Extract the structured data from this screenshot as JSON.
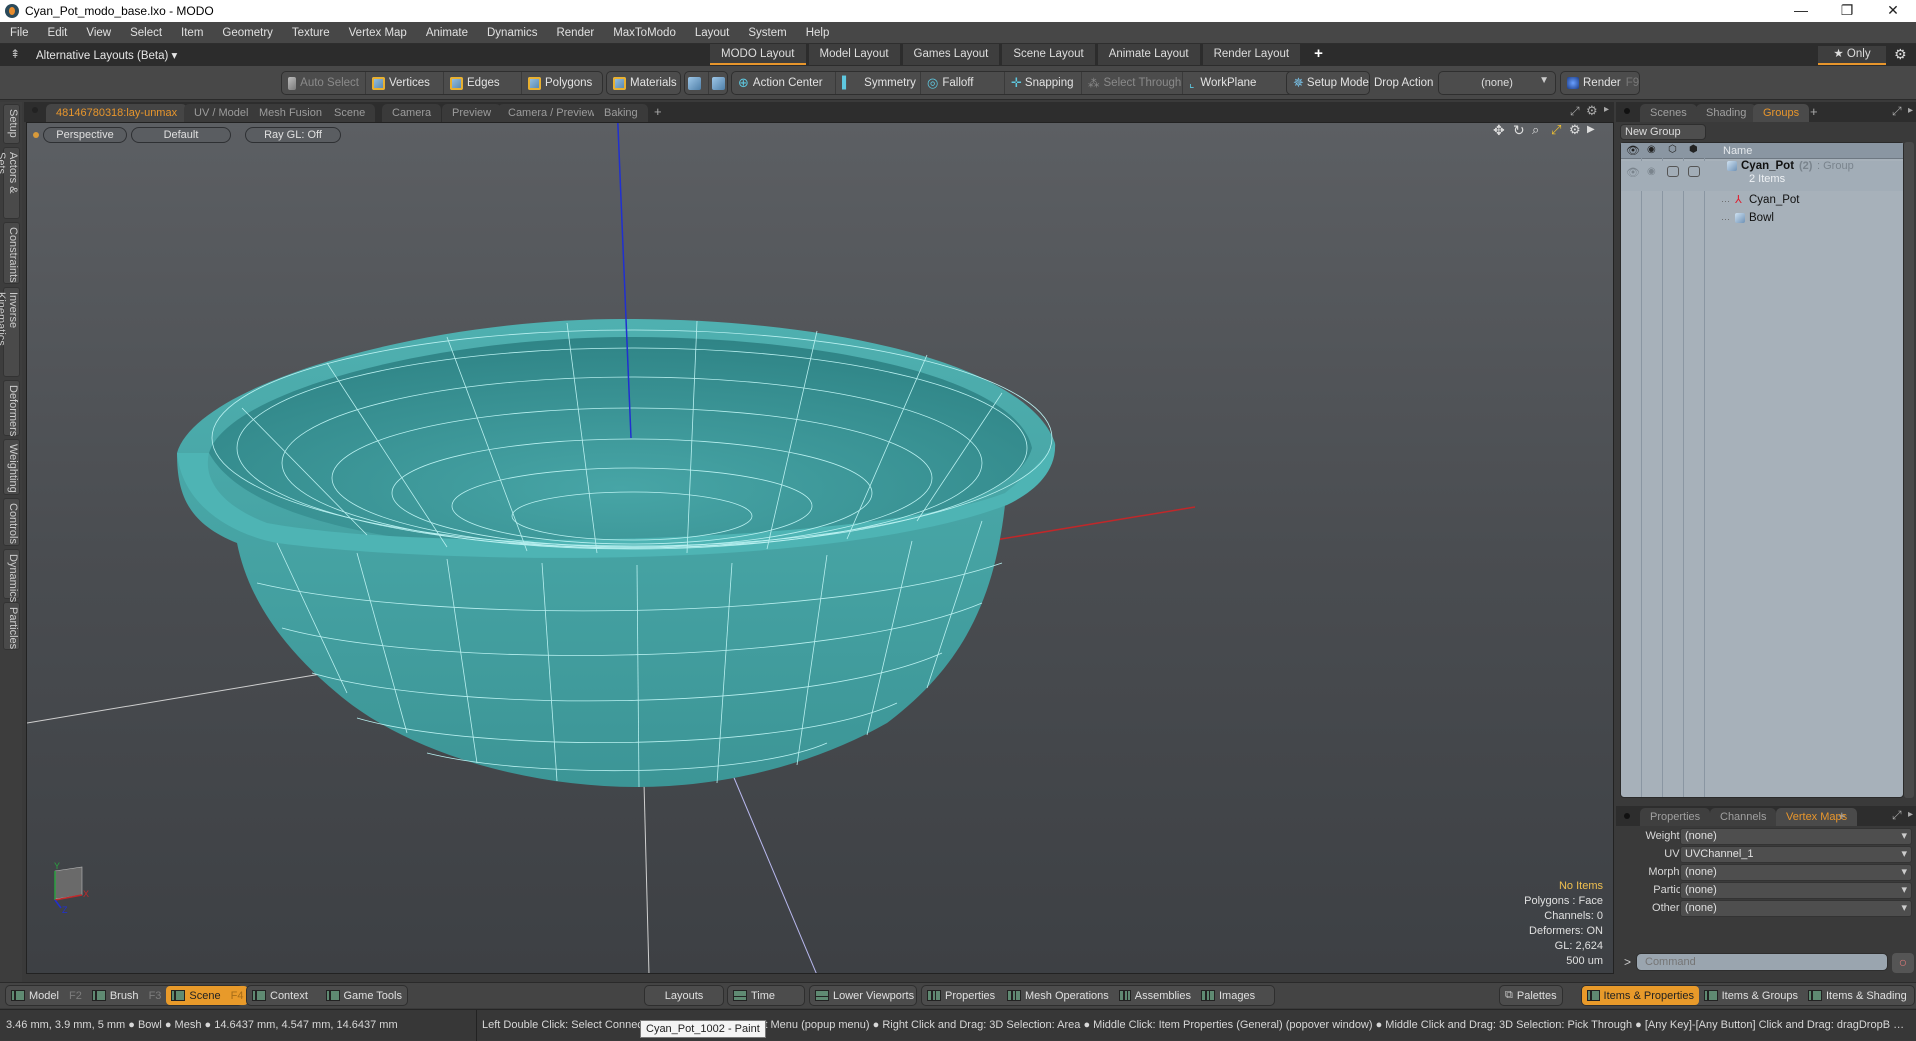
{
  "window": {
    "title": "Cyan_Pot_modo_base.lxo - MODO",
    "controls": {
      "minimize": "—",
      "restore": "❐",
      "close": "✕"
    }
  },
  "menubar": [
    "File",
    "Edit",
    "View",
    "Select",
    "Item",
    "Geometry",
    "Texture",
    "Vertex Map",
    "Animate",
    "Dynamics",
    "Render",
    "MaxToModo",
    "Layout",
    "System",
    "Help"
  ],
  "layoutbar": {
    "alt_layouts": "Alternative Layouts (Beta) ▾",
    "tabs": [
      "MODO Layout",
      "Model Layout",
      "Games Layout",
      "Scene Layout",
      "Animate Layout",
      "Render Layout"
    ],
    "active_tab": "MODO Layout",
    "add": "+",
    "only": "★  Only",
    "gear": "⚙"
  },
  "toolbar": {
    "auto_select": "Auto Select",
    "vertices": "Vertices",
    "edges": "Edges",
    "polygons": "Polygons",
    "materials": "Materials",
    "action_center": "Action Center",
    "symmetry": "Symmetry",
    "falloff": "Falloff",
    "snapping": "Snapping",
    "select_through": "Select Through",
    "workplane": "WorkPlane",
    "setup_mode": "Setup Mode",
    "drop_action_label": "Drop Action",
    "drop_action_value": "(none)",
    "render": "Render",
    "render_key": "F9"
  },
  "left_tabs": [
    "Setup",
    "Actors & Sets",
    "Constraints",
    "Inverse Kinematics",
    "Deformers",
    "Weighting",
    "Controls",
    "Dynamics",
    "Particles"
  ],
  "viewport_tabs": {
    "items": [
      "48146780318:lay-unmax",
      "UV / Model",
      "Mesh Fusion",
      "Scene",
      "Camera",
      "Preview",
      "Camera / Preview",
      "Baking"
    ],
    "active": "48146780318:lay-unmax",
    "add": "+"
  },
  "viewport": {
    "view": "Perspective",
    "style": "Default",
    "raygl": "Ray GL: Off",
    "colors": {
      "mesh": "#3f9a9c",
      "wire": "#b8f0f0",
      "x_axis": "#c0282a",
      "y_axis": "#2aa040",
      "z_axis": "#2030d0"
    },
    "info": {
      "selection": "No Items",
      "polygons": "Polygons : Face",
      "channels": "Channels: 0",
      "deformers": "Deformers: ON",
      "gl": "GL: 2,624",
      "scale": "500 um"
    },
    "axis_labels": {
      "x": "X",
      "y": "Y",
      "z": "Z"
    }
  },
  "right_panel": {
    "top_tabs": [
      "Scenes",
      "Shading",
      "Groups"
    ],
    "top_active": "Groups",
    "new_group": "New Group",
    "column_name": "Name",
    "group": {
      "name": "Cyan_Pot",
      "count": "(2)",
      "type": ": Group",
      "subtitle": "2 Items",
      "children": [
        "Cyan_Pot",
        "Bowl"
      ]
    },
    "bottom_tabs": [
      "Properties",
      "Channels",
      "Vertex Maps"
    ],
    "bottom_active": "Vertex Maps",
    "vertex_maps": [
      {
        "label": "Weight Map",
        "value": "(none)"
      },
      {
        "label": "UV Map",
        "value": "UVChannel_1"
      },
      {
        "label": "Morph Map",
        "value": "(none)"
      },
      {
        "label": "Particle  …",
        "value": "(none)"
      },
      {
        "label": "Other Map",
        "value": "(none)"
      }
    ],
    "command_placeholder": "Command",
    "command_prompt": ">"
  },
  "bottombar": {
    "left": [
      {
        "label": "Model",
        "key": "F2"
      },
      {
        "label": "Brush",
        "key": "F3"
      },
      {
        "label": "Scene",
        "key": "F4",
        "active": true
      }
    ],
    "left2": [
      "Context",
      "Game Tools"
    ],
    "center": [
      "Layouts",
      "Time",
      "Lower Viewports",
      "Properties",
      "Mesh Operations",
      "Assemblies",
      "Images"
    ],
    "palettes": "Palettes",
    "right": [
      "Items & Properties",
      "Items & Groups",
      "Items & Shading"
    ],
    "right_active": "Items & Properties"
  },
  "statusbar": {
    "left": "3.46 mm, 3.9 mm, 5 mm ● Bowl ● Mesh ● 14.6437 mm, 4.547 mm, 14.6437 mm",
    "right": "Left Double Click: Select Connected ● Right Click: Context Menu (popup menu) ● Right Click and Drag: 3D Selection: Area ● Middle Click: Item Properties (General) (popover window) ● Middle Click and Drag: 3D Selection: Pick Through ● [Any Key]-[Any Button] Click and Drag: dragDropB …",
    "tooltip": "Cyan_Pot_1002 - Paint"
  }
}
